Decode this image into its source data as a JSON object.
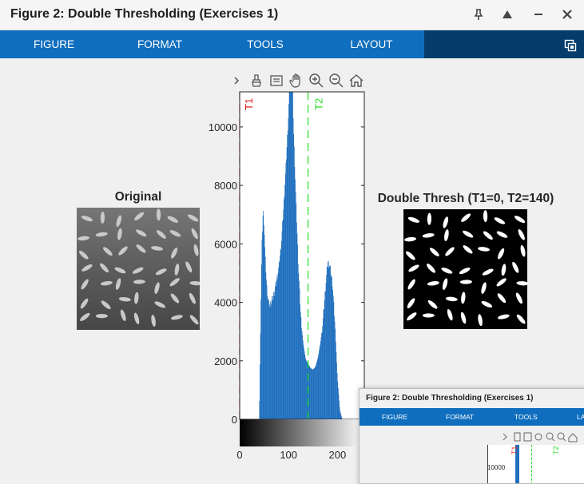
{
  "window": {
    "title": "Figure 2: Double Thresholding (Exercises 1)"
  },
  "toolstrip": {
    "tabs": [
      "FIGURE",
      "FORMAT",
      "TOOLS",
      "LAYOUT"
    ]
  },
  "figure": {
    "left_title": "Original",
    "right_title": "Double Thresh (T1=0, T2=140)",
    "histogram": {
      "y_ticks": [
        "0",
        "2000",
        "4000",
        "6000",
        "8000",
        "10000"
      ],
      "x_ticks": [
        "0",
        "100",
        "200"
      ],
      "t1_label": "T1",
      "t2_label": "T2"
    }
  },
  "mini_window": {
    "title": "Figure 2: Double Thresholding (Exercises 1)",
    "tabs": [
      "FIGURE",
      "FORMAT",
      "TOOLS",
      "LA"
    ],
    "y_tick": "10000",
    "t1_label": "T1",
    "t2_label": "T2"
  },
  "chart_data": {
    "type": "area",
    "title": "",
    "xlabel": "",
    "ylabel": "",
    "xlim": [
      0,
      255
    ],
    "ylim": [
      0,
      11200
    ],
    "x_ticks": [
      0,
      100,
      200
    ],
    "y_ticks": [
      0,
      2000,
      4000,
      6000,
      8000,
      10000
    ],
    "x": [
      0,
      40,
      42,
      45,
      48,
      50,
      52,
      55,
      58,
      60,
      65,
      70,
      75,
      80,
      85,
      90,
      95,
      100,
      103,
      105,
      108,
      110,
      115,
      120,
      125,
      130,
      135,
      140,
      145,
      150,
      155,
      160,
      165,
      170,
      175,
      180,
      185,
      190,
      195,
      200,
      205,
      210
    ],
    "y": [
      0,
      0,
      2500,
      5800,
      7200,
      6600,
      5600,
      4600,
      4100,
      3900,
      4000,
      4300,
      4700,
      5200,
      6000,
      7300,
      8800,
      10500,
      12000,
      12000,
      11500,
      10000,
      7500,
      5200,
      3500,
      2600,
      2050,
      1900,
      1750,
      1700,
      1800,
      2100,
      2600,
      3300,
      4400,
      5400,
      5200,
      4600,
      3200,
      1400,
      300,
      0
    ],
    "thresholds": {
      "T1": 0,
      "T2": 140
    },
    "colorbar": "gray",
    "grid": false
  }
}
